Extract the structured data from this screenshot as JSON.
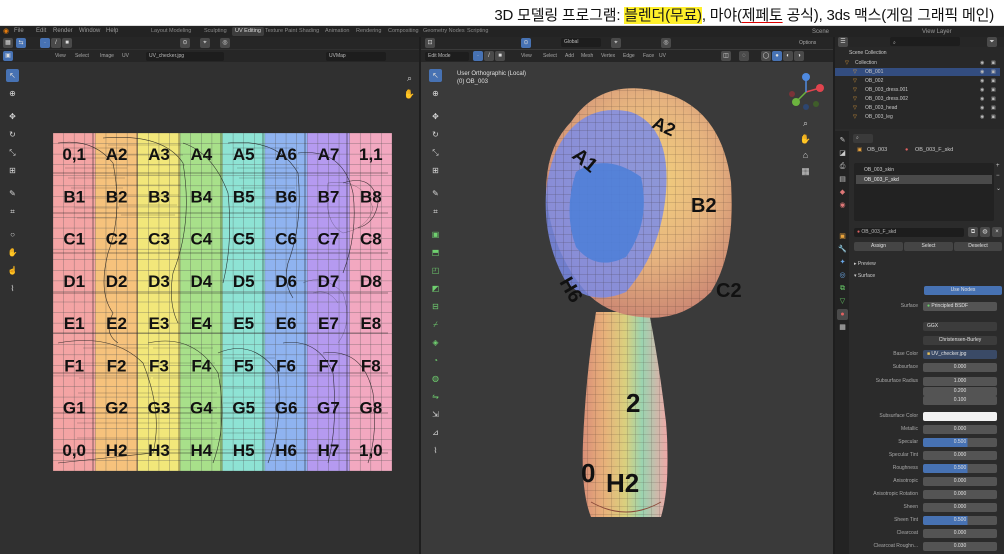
{
  "banner": {
    "part1": "3D 모델링 프로그램: ",
    "part2": "블렌더(무료)",
    "part3": ", 마야(",
    "part4": "제페토",
    "part5": " 공식), 3ds 맥스(게임 그래픽 메인)"
  },
  "menu": [
    "File",
    "Edit",
    "Render",
    "Window",
    "Help"
  ],
  "workspace_tabs": [
    "Layout",
    "Modeling",
    "Sculpting",
    "UV Editing",
    "Texture Paint",
    "Shading",
    "Animation",
    "Rendering",
    "Compositing",
    "Geometry Nodes",
    "Scripting"
  ],
  "active_workspace": "UV Editing",
  "scene": {
    "label": "Scene",
    "view_layer": "View Layer"
  },
  "uv_editor": {
    "header_menus": [
      "View",
      "Select",
      "Image",
      "UV"
    ],
    "image_name": "UV_checker.jpg",
    "uv_map": "UVMap",
    "grid_labels": [
      [
        "0,1",
        "A2",
        "A3",
        "A4",
        "A5",
        "A6",
        "A7",
        "1,1"
      ],
      [
        "B1",
        "B2",
        "B3",
        "B4",
        "B5",
        "B6",
        "B7",
        "B8"
      ],
      [
        "C1",
        "C2",
        "C3",
        "C4",
        "C5",
        "C6",
        "C7",
        "C8"
      ],
      [
        "D1",
        "D2",
        "D3",
        "D4",
        "D5",
        "D6",
        "D7",
        "D8"
      ],
      [
        "E1",
        "E2",
        "E3",
        "E4",
        "E5",
        "E6",
        "E7",
        "E8"
      ],
      [
        "F1",
        "F2",
        "F3",
        "F4",
        "F5",
        "F6",
        "F7",
        "F8"
      ],
      [
        "G1",
        "G2",
        "G3",
        "G4",
        "G5",
        "G6",
        "G7",
        "G8"
      ],
      [
        "0,0",
        "H2",
        "H3",
        "H4",
        "H5",
        "H6",
        "H7",
        "1,0"
      ]
    ],
    "column_colors": [
      "#f4a4a4",
      "#f6c27c",
      "#f2e77a",
      "#a8e08a",
      "#8ee3d4",
      "#8fb3f0",
      "#b59af0",
      "#f2a8c0"
    ]
  },
  "viewport": {
    "mode": "Edit Mode",
    "header_menus": [
      "View",
      "Select",
      "Add",
      "Mesh",
      "Vertex",
      "Edge",
      "Face",
      "UV"
    ],
    "orientation": "Global",
    "options": "Options",
    "overlay_line1": "User Orthographic (Local)",
    "overlay_line2": "(0) OB_003",
    "gizmo": {
      "x": "X",
      "y": "Y",
      "z": "Z"
    },
    "model_labels": [
      "A1",
      "A2",
      "B2",
      "C2",
      "H6",
      "2",
      "H2",
      "0"
    ]
  },
  "outliner": {
    "title": "Scene Collection",
    "items": [
      "Collection",
      "OB_001",
      "OB_002",
      "OB_003_dress.001",
      "OB_003_dress.002",
      "OB_003_head",
      "OB_003_leg"
    ],
    "selected_index": 1
  },
  "properties": {
    "object_name": "OB_003",
    "material_name": "OB_003_F_skd",
    "material_slots": [
      "OB_003_skin",
      "OB_003_F_skd"
    ],
    "material_field": "OB_003_F_skd",
    "slot_buttons": [
      "Assign",
      "Select",
      "Deselect"
    ],
    "sections": [
      "Preview",
      "Surface"
    ],
    "use_nodes": "Use Nodes",
    "surface_label": "Surface",
    "surface_value": "Principled BSDF",
    "distribution": "GGX",
    "subsurface_method": "Christensen-Burley",
    "base_color_label": "Base Color",
    "base_color_value": "UV_checker.jpg",
    "rows": [
      {
        "label": "Subsurface",
        "value": "0.000",
        "style": "plain"
      },
      {
        "label": "Subsurface Radius",
        "value": "1.000",
        "style": "plain"
      },
      {
        "label": "",
        "value": "0.200",
        "style": "plain"
      },
      {
        "label": "",
        "value": "0.100",
        "style": "plain"
      },
      {
        "label": "Subsurface Color",
        "value": "",
        "style": "white"
      },
      {
        "label": "Metallic",
        "value": "0.000",
        "style": "plain"
      },
      {
        "label": "Specular",
        "value": "0.500",
        "style": "blue"
      },
      {
        "label": "Specular Tint",
        "value": "0.000",
        "style": "plain"
      },
      {
        "label": "Roughness",
        "value": "0.500",
        "style": "blue"
      },
      {
        "label": "Anisotropic",
        "value": "0.000",
        "style": "plain"
      },
      {
        "label": "Anisotropic Rotation",
        "value": "0.000",
        "style": "plain"
      },
      {
        "label": "Sheen",
        "value": "0.000",
        "style": "plain"
      },
      {
        "label": "Sheen Tint",
        "value": "0.500",
        "style": "blue"
      },
      {
        "label": "Clearcoat",
        "value": "0.000",
        "style": "plain"
      },
      {
        "label": "Clearcoat Roughn...",
        "value": "0.030",
        "style": "plain"
      }
    ]
  },
  "colors": {
    "accent": "#4772b3",
    "banner_highlight": "#fff02a"
  },
  "icons": [
    "blender-logo-icon",
    "select-box-icon",
    "cursor-icon",
    "move-icon",
    "rotate-icon",
    "scale-icon",
    "transform-icon",
    "annotate-icon",
    "measure-icon",
    "grab-icon",
    "zoom-icon",
    "hand-icon",
    "material-icon",
    "object-icon",
    "modifier-icon",
    "scene-icon",
    "world-icon",
    "search-icon",
    "eye-icon",
    "camera-icon"
  ]
}
